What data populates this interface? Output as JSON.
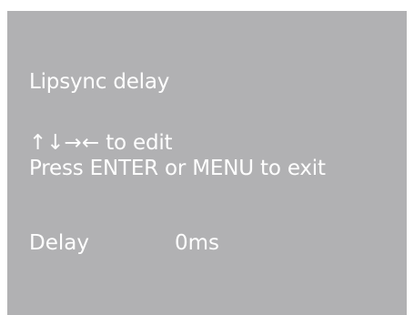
{
  "osd": {
    "title": "Lipsync delay",
    "hint": {
      "arrows": "↑↓→←",
      "edit_text": " to edit",
      "exit_text": "Press ENTER or MENU to exit"
    },
    "setting": {
      "label": "Delay",
      "value": "0ms"
    }
  },
  "colors": {
    "panel_background": "#b1b1b3",
    "text": "#ffffff"
  }
}
